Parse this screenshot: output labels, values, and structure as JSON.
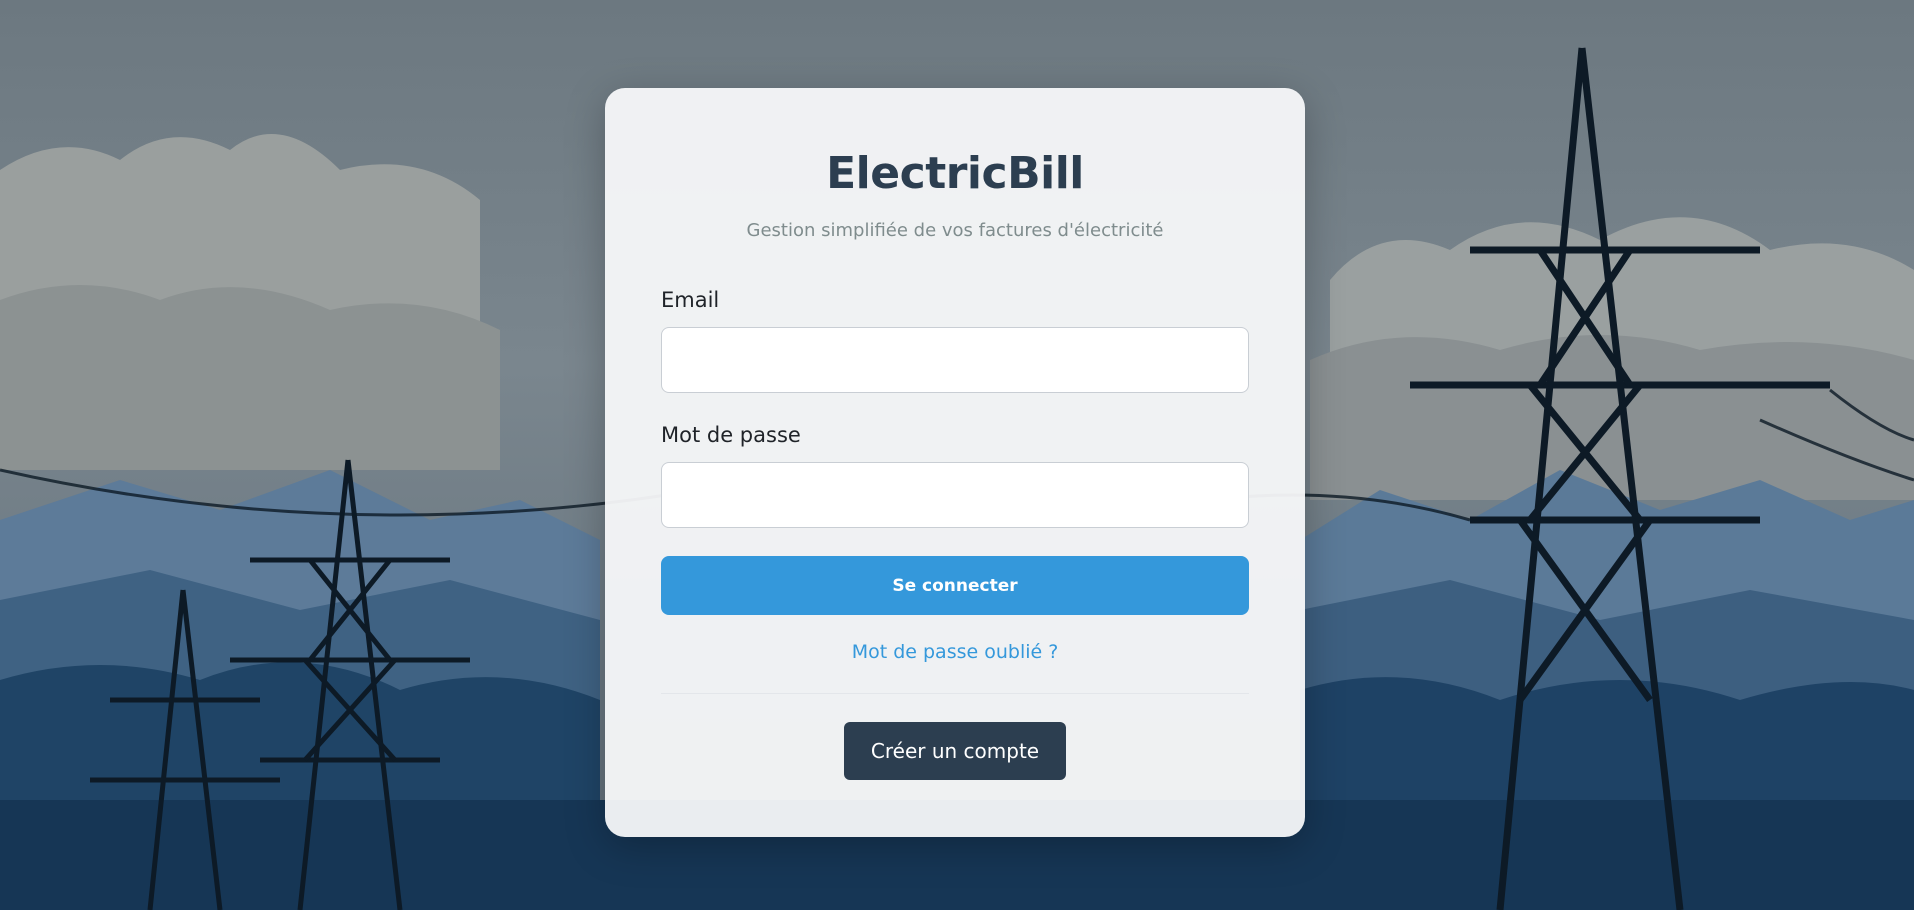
{
  "app": {
    "title": "ElectricBill",
    "subtitle": "Gestion simplifiée de vos factures d'électricité"
  },
  "form": {
    "email_label": "Email",
    "email_value": "",
    "email_placeholder": "",
    "password_label": "Mot de passe",
    "password_value": "",
    "password_placeholder": "",
    "login_label": "Se connecter",
    "forgot_label": "Mot de passe oublié ?",
    "create_account_label": "Créer un compte"
  },
  "colors": {
    "primary": "#3498db",
    "dark": "#2c3e50",
    "muted": "#7f8c8d"
  }
}
